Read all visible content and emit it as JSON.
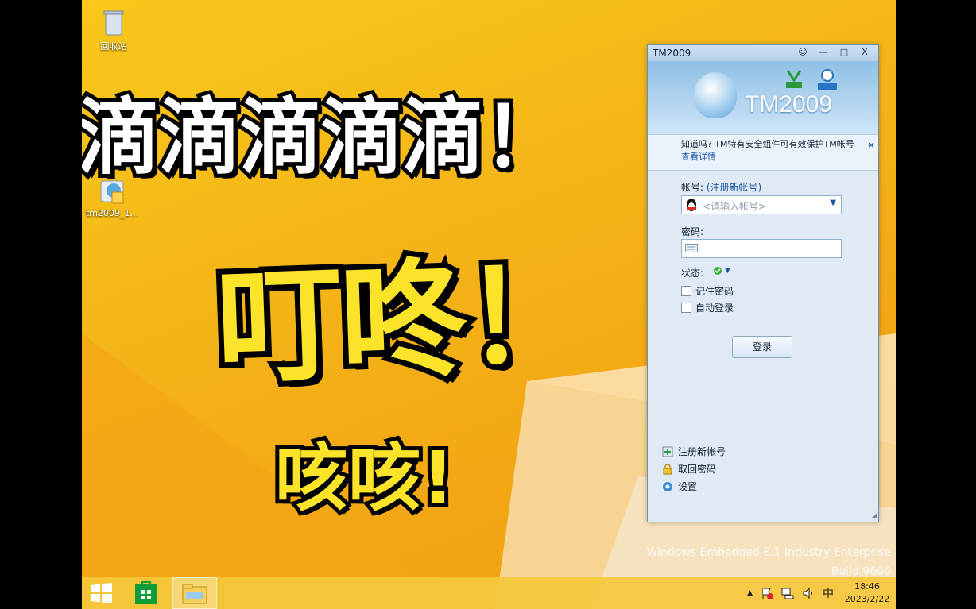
{
  "desktop": {
    "icons": [
      {
        "label": "回收站"
      },
      {
        "label": "tm2009_1..."
      }
    ],
    "watermark": {
      "line1": "Windows Embedded 8.1 Industry Enterprise",
      "line2": "Build 9600"
    }
  },
  "overlay": {
    "title1": "滴滴滴滴滴！",
    "title2": "叮咚！",
    "title3": "咳咳!"
  },
  "tm_window": {
    "title": "TM2009",
    "controls": [
      "☺",
      "—",
      "□",
      "X"
    ],
    "logo": "TM2009",
    "notice": {
      "text": "知道吗? TM特有安全组件可有效保护TM帐号",
      "link": "查看详情"
    },
    "account_label": "帐号:",
    "register_link": "(注册新帐号)",
    "account_placeholder": "<请输入帐号>",
    "password_label": "密码:",
    "status_label": "状态:",
    "remember_password": "记住密码",
    "auto_login": "自动登录",
    "login_button": "登录",
    "bottom_links": [
      "注册新帐号",
      "取回密码",
      "设置"
    ]
  },
  "taskbar": {
    "tray": {
      "ime": "中",
      "time": "18:46",
      "date": "2023/2/22"
    }
  },
  "colors": {
    "wallpaper": "#f4b217",
    "title_yellow": "#fbe32a",
    "tm_blue": "#1a56a8"
  }
}
